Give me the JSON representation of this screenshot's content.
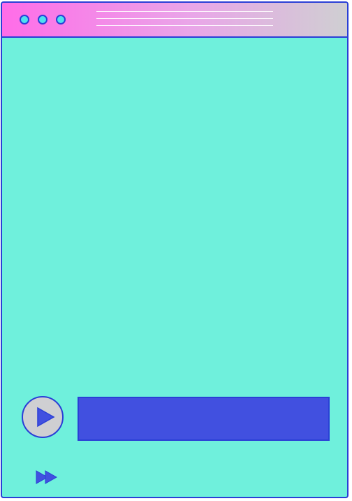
{
  "window": {
    "title_icons": [
      "window-dot-icon",
      "window-dot-icon",
      "window-dot-icon"
    ],
    "colors": {
      "background": "#6ff0dc",
      "titlebar_start": "#ff6ce8",
      "titlebar_end": "#cfcfd2",
      "border": "#2a3fd6",
      "accent": "#4150e0"
    }
  },
  "player": {
    "play_icon": "play-icon",
    "forward_icon": "fast-forward-icon",
    "progress_fraction": 1.0
  }
}
